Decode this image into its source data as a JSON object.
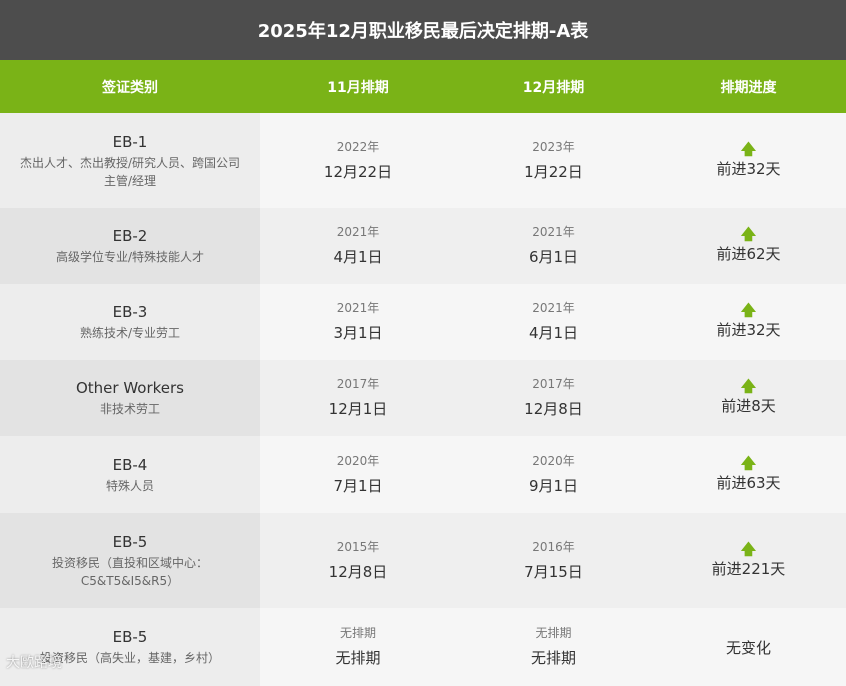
{
  "title": "2025年12月职业移民最后决定排期-A表",
  "headers": [
    "签证类别",
    "11月排期",
    "12月排期",
    "排期进度"
  ],
  "rows": [
    {
      "name": "EB-1",
      "desc": "杰出人才、杰出教授/研究人员、跨国公司主管/经理",
      "nov_year": "2022年",
      "nov_date": "12月22日",
      "dec_year": "2023年",
      "dec_date": "1月22日",
      "arrow": "up-arrow-icon",
      "progress": "前进32天"
    },
    {
      "name": "EB-2",
      "desc": "高级学位专业/特殊技能人才",
      "nov_year": "2021年",
      "nov_date": "4月1日",
      "dec_year": "2021年",
      "dec_date": "6月1日",
      "arrow": "up-arrow-icon",
      "progress": "前进62天"
    },
    {
      "name": "EB-3",
      "desc": "熟练技术/专业劳工",
      "nov_year": "2021年",
      "nov_date": "3月1日",
      "dec_year": "2021年",
      "dec_date": "4月1日",
      "arrow": "up-arrow-icon",
      "progress": "前进32天"
    },
    {
      "name": "Other Workers",
      "desc": "非技术劳工",
      "nov_year": "2017年",
      "nov_date": "12月1日",
      "dec_year": "2017年",
      "dec_date": "12月8日",
      "arrow": "up-arrow-icon",
      "progress": "前进8天"
    },
    {
      "name": "EB-4",
      "desc": "特殊人员",
      "nov_year": "2020年",
      "nov_date": "7月1日",
      "dec_year": "2020年",
      "dec_date": "9月1日",
      "arrow": "up-arrow-icon",
      "progress": "前进63天"
    },
    {
      "name": "EB-5",
      "desc": "投资移民（直投和区域中心：C5&T5&I5&R5）",
      "nov_year": "2015年",
      "nov_date": "12月8日",
      "dec_year": "2016年",
      "dec_date": "7月15日",
      "arrow": "up-arrow-icon",
      "progress": "前进221天"
    },
    {
      "name": "EB-5",
      "desc": "投资移民（高失业，基建，乡村）",
      "nov_year": "无排期",
      "nov_date": "无排期",
      "dec_year": "无排期",
      "dec_date": "无排期",
      "arrow": "",
      "progress": "无变化"
    }
  ],
  "watermark": "大歐路境",
  "colors": {
    "title_bg": "#4d4d4d",
    "header_bg": "#7ab317",
    "arrow": "#7ab317"
  }
}
